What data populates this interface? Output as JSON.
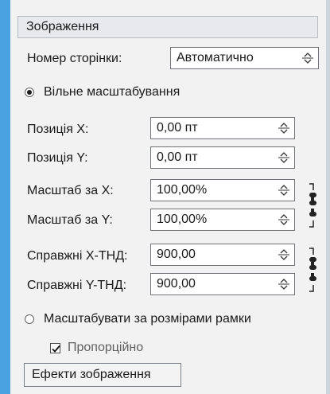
{
  "panel": {
    "section_title": "Зображення",
    "page_number": {
      "label": "Номер сторінки:",
      "value": "Автоматично"
    },
    "free_scale_label": "Вільне масштабування",
    "position_x": {
      "label": "Позиція X:",
      "value": "0,00 пт"
    },
    "position_y": {
      "label": "Позиція Y:",
      "value": "0,00 пт"
    },
    "scale_x": {
      "label": "Масштаб за X:",
      "value": "100,00%"
    },
    "scale_y": {
      "label": "Масштаб за Y:",
      "value": "100,00%"
    },
    "actual_x_dpi": {
      "label": "Справжні X-ТНД:",
      "value": "900,00"
    },
    "actual_y_dpi": {
      "label": "Справжні Y-ТНД:",
      "value": "900,00"
    },
    "fit_frame_label": "Масштабувати за розмірами рамки",
    "proportional_label": "Пропорційно",
    "effects_button_label": "Ефекти зображення"
  },
  "state": {
    "free_scale_selected": true,
    "fit_frame_selected": false,
    "proportional_checked": true
  },
  "colors": {
    "accent_strip": "#4aa3e0",
    "panel_bg": "#f2f2f2"
  }
}
